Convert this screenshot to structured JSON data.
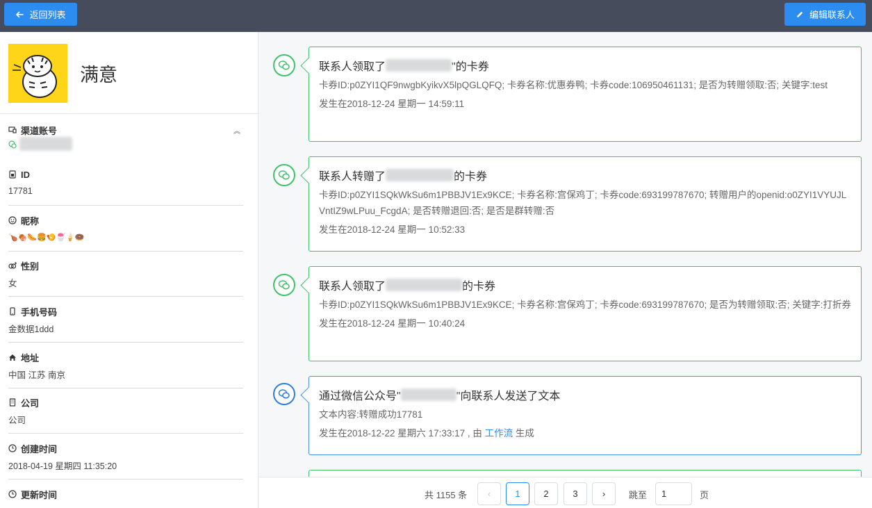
{
  "topbar": {
    "back_label": "返回列表",
    "edit_label": "编辑联系人"
  },
  "profile": {
    "name": "满意"
  },
  "fields": {
    "channel": {
      "label": "渠道账号"
    },
    "id": {
      "label": "ID",
      "value": "17781"
    },
    "nickname": {
      "label": "昵称",
      "value": "🍗🍖🌭🍔🍤🍧🍦🍩"
    },
    "gender": {
      "label": "性别",
      "value": "女"
    },
    "phone": {
      "label": "手机号码",
      "value": "金数据1ddd"
    },
    "address": {
      "label": "地址",
      "value": "中国 江苏 南京"
    },
    "company": {
      "label": "公司",
      "value": "公司"
    },
    "created": {
      "label": "创建时间",
      "value": "2018-04-19 星期四 11:35:20"
    },
    "updated": {
      "label": "更新时间"
    }
  },
  "timeline": [
    {
      "title_pre": "联系人领取了",
      "title_post": "\"的卡券",
      "desc": "卡券ID:p0ZYI1QF9nwgbKyikvX5lpQGLQFQ; 卡券名称:优惠券鸭; 卡券code:106950461131; 是否为转赠领取:否; 关键字:test",
      "time": "发生在2018-12-24 星期一 14:59:11"
    },
    {
      "title_pre": "联系人转赠了",
      "title_post": "的卡券",
      "desc": "卡券ID:p0ZYI1SQkWkSu6m1PBBJV1Ex9KCE; 卡券名称:宫保鸡丁; 卡券code:693199787670; 转赠用户的openid:o0ZYI1VYUJLVntIZ9wLPuu_FcgdA; 是否转赠退回:否; 是否是群转赠:否",
      "time": "发生在2018-12-24 星期一 10:52:33"
    },
    {
      "title_pre": "联系人领取了",
      "title_post": "的卡券",
      "desc": "卡券ID:p0ZYI1SQkWkSu6m1PBBJV1Ex9KCE; 卡券名称:宫保鸡丁; 卡券code:693199787670; 是否为转赠领取:否; 关键字:打折券",
      "time": "发生在2018-12-24 星期一 10:40:24"
    },
    {
      "title_pre": "通过微信公众号\"",
      "title_post": "\"向联系人发送了文本",
      "desc": "文本内容:转赠成功17781",
      "time_pre": "发生在2018-12-22 星期六 17:33:17 , 由 ",
      "time_link": "工作流",
      "time_post": " 生成"
    }
  ],
  "pagination": {
    "total_text": "共 1155 条",
    "prev": "‹",
    "pages": [
      "1",
      "2",
      "3"
    ],
    "next": "›",
    "jump_label": "跳至",
    "jump_value": "1",
    "jump_unit": "页"
  },
  "colors": {
    "topbar": "#464c5b",
    "primary": "#2d8cf0",
    "wechat_green": "#3fc26b",
    "avatar_bg": "#ffd519"
  }
}
